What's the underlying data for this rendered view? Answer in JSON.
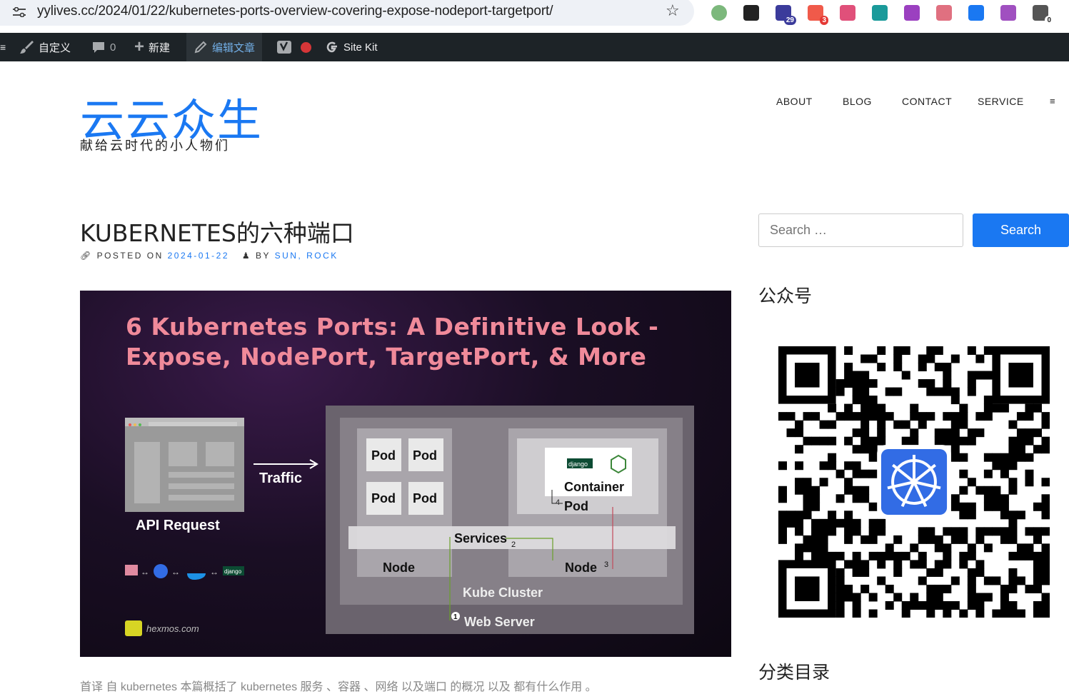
{
  "browser": {
    "url": "yylives.cc/2024/01/22/kubernetes-ports-overview-covering-expose-nodeport-targetport/",
    "extensions": [
      {
        "name": "circle-extension-icon",
        "color": "#7cb87c",
        "badge": ""
      },
      {
        "name": "notion-icon",
        "color": "#222222",
        "badge": ""
      },
      {
        "name": "graduation-cap-icon",
        "color": "#3b3b9b",
        "badge": "29"
      },
      {
        "name": "stack-extension-icon",
        "color": "#f05a4a",
        "badge": "3"
      },
      {
        "name": "translate-icon",
        "color": "#e0507a",
        "badge": ""
      },
      {
        "name": "grid-extension-icon",
        "color": "#1a9a9a",
        "badge": ""
      },
      {
        "name": "lr-extension-icon",
        "color": "#9b40c0",
        "badge": ""
      },
      {
        "name": "crown-extension-icon",
        "color": "#e07080",
        "badge": ""
      },
      {
        "name": "feather-extension-icon",
        "color": "#1a78f2",
        "badge": ""
      },
      {
        "name": "openai-icon",
        "color": "#a050c0",
        "badge": ""
      },
      {
        "name": "refresh-extension-icon",
        "color": "#555555",
        "badge": "0"
      }
    ]
  },
  "admin_bar": {
    "menu_glyph": "≡",
    "customize": "自定义",
    "comments_count": "0",
    "new": "新建",
    "edit_post": "编辑文章",
    "site_kit": "Site Kit"
  },
  "site": {
    "title": "云云众生",
    "tagline": "献给云时代的小人物们",
    "accent_color": "#1a78f2"
  },
  "nav": {
    "items": [
      "ABOUT",
      "BLOG",
      "CONTACT",
      "SERVICE"
    ],
    "menu_icon": "≡"
  },
  "post": {
    "title": "KUBERNETES的六种端口",
    "posted_on_label": "POSTED ON",
    "date": "2024-01-22",
    "by_label": "BY",
    "author": "SUN, ROCK",
    "bottom_text": "首译 自 kubernetes 本篇概括了 kubernetes 服务 、容器 、网络 以及端口 的概况 以及 都有什么作用 。 "
  },
  "hero": {
    "title": "6 Kubernetes Ports: A Definitive Look - Expose, NodePort, TargetPort, & More",
    "api_request": "API Request",
    "traffic": "Traffic",
    "pod": "Pod",
    "container": "Container",
    "services": "Services",
    "node": "Node",
    "kube_cluster": "Kube Cluster",
    "web_server": "Web Server",
    "django": "django",
    "hexmos": "hexmos.com",
    "num1": "1",
    "num2": "2",
    "num3": "3",
    "num4": "4"
  },
  "sidebar": {
    "search_placeholder": "Search …",
    "search_button": "Search",
    "widget1_title": "公众号",
    "widget2_title": "分类目录"
  }
}
